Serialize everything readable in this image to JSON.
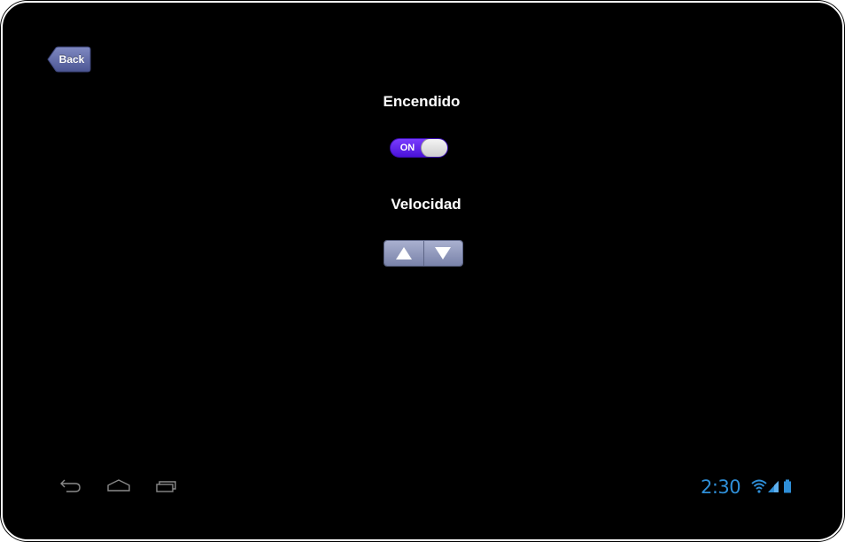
{
  "header": {
    "back_label": "Back"
  },
  "controls": {
    "power_label": "Encendido",
    "power_toggle_state": "ON",
    "speed_label": "Velocidad"
  },
  "icons": {
    "up": "triangle-up-icon",
    "down": "triangle-down-icon",
    "nav_back": "back-arrow-icon",
    "nav_home": "home-icon",
    "nav_recent": "recent-apps-icon",
    "wifi": "wifi-icon",
    "signal": "signal-icon",
    "battery": "battery-icon"
  },
  "status_bar": {
    "time": "2:30"
  },
  "colors": {
    "background": "#000000",
    "toggle_on": "#5a1ef0",
    "stepper": "#8f97bd",
    "back_button": "#5c67a3",
    "status_accent": "#2f8fd8"
  }
}
